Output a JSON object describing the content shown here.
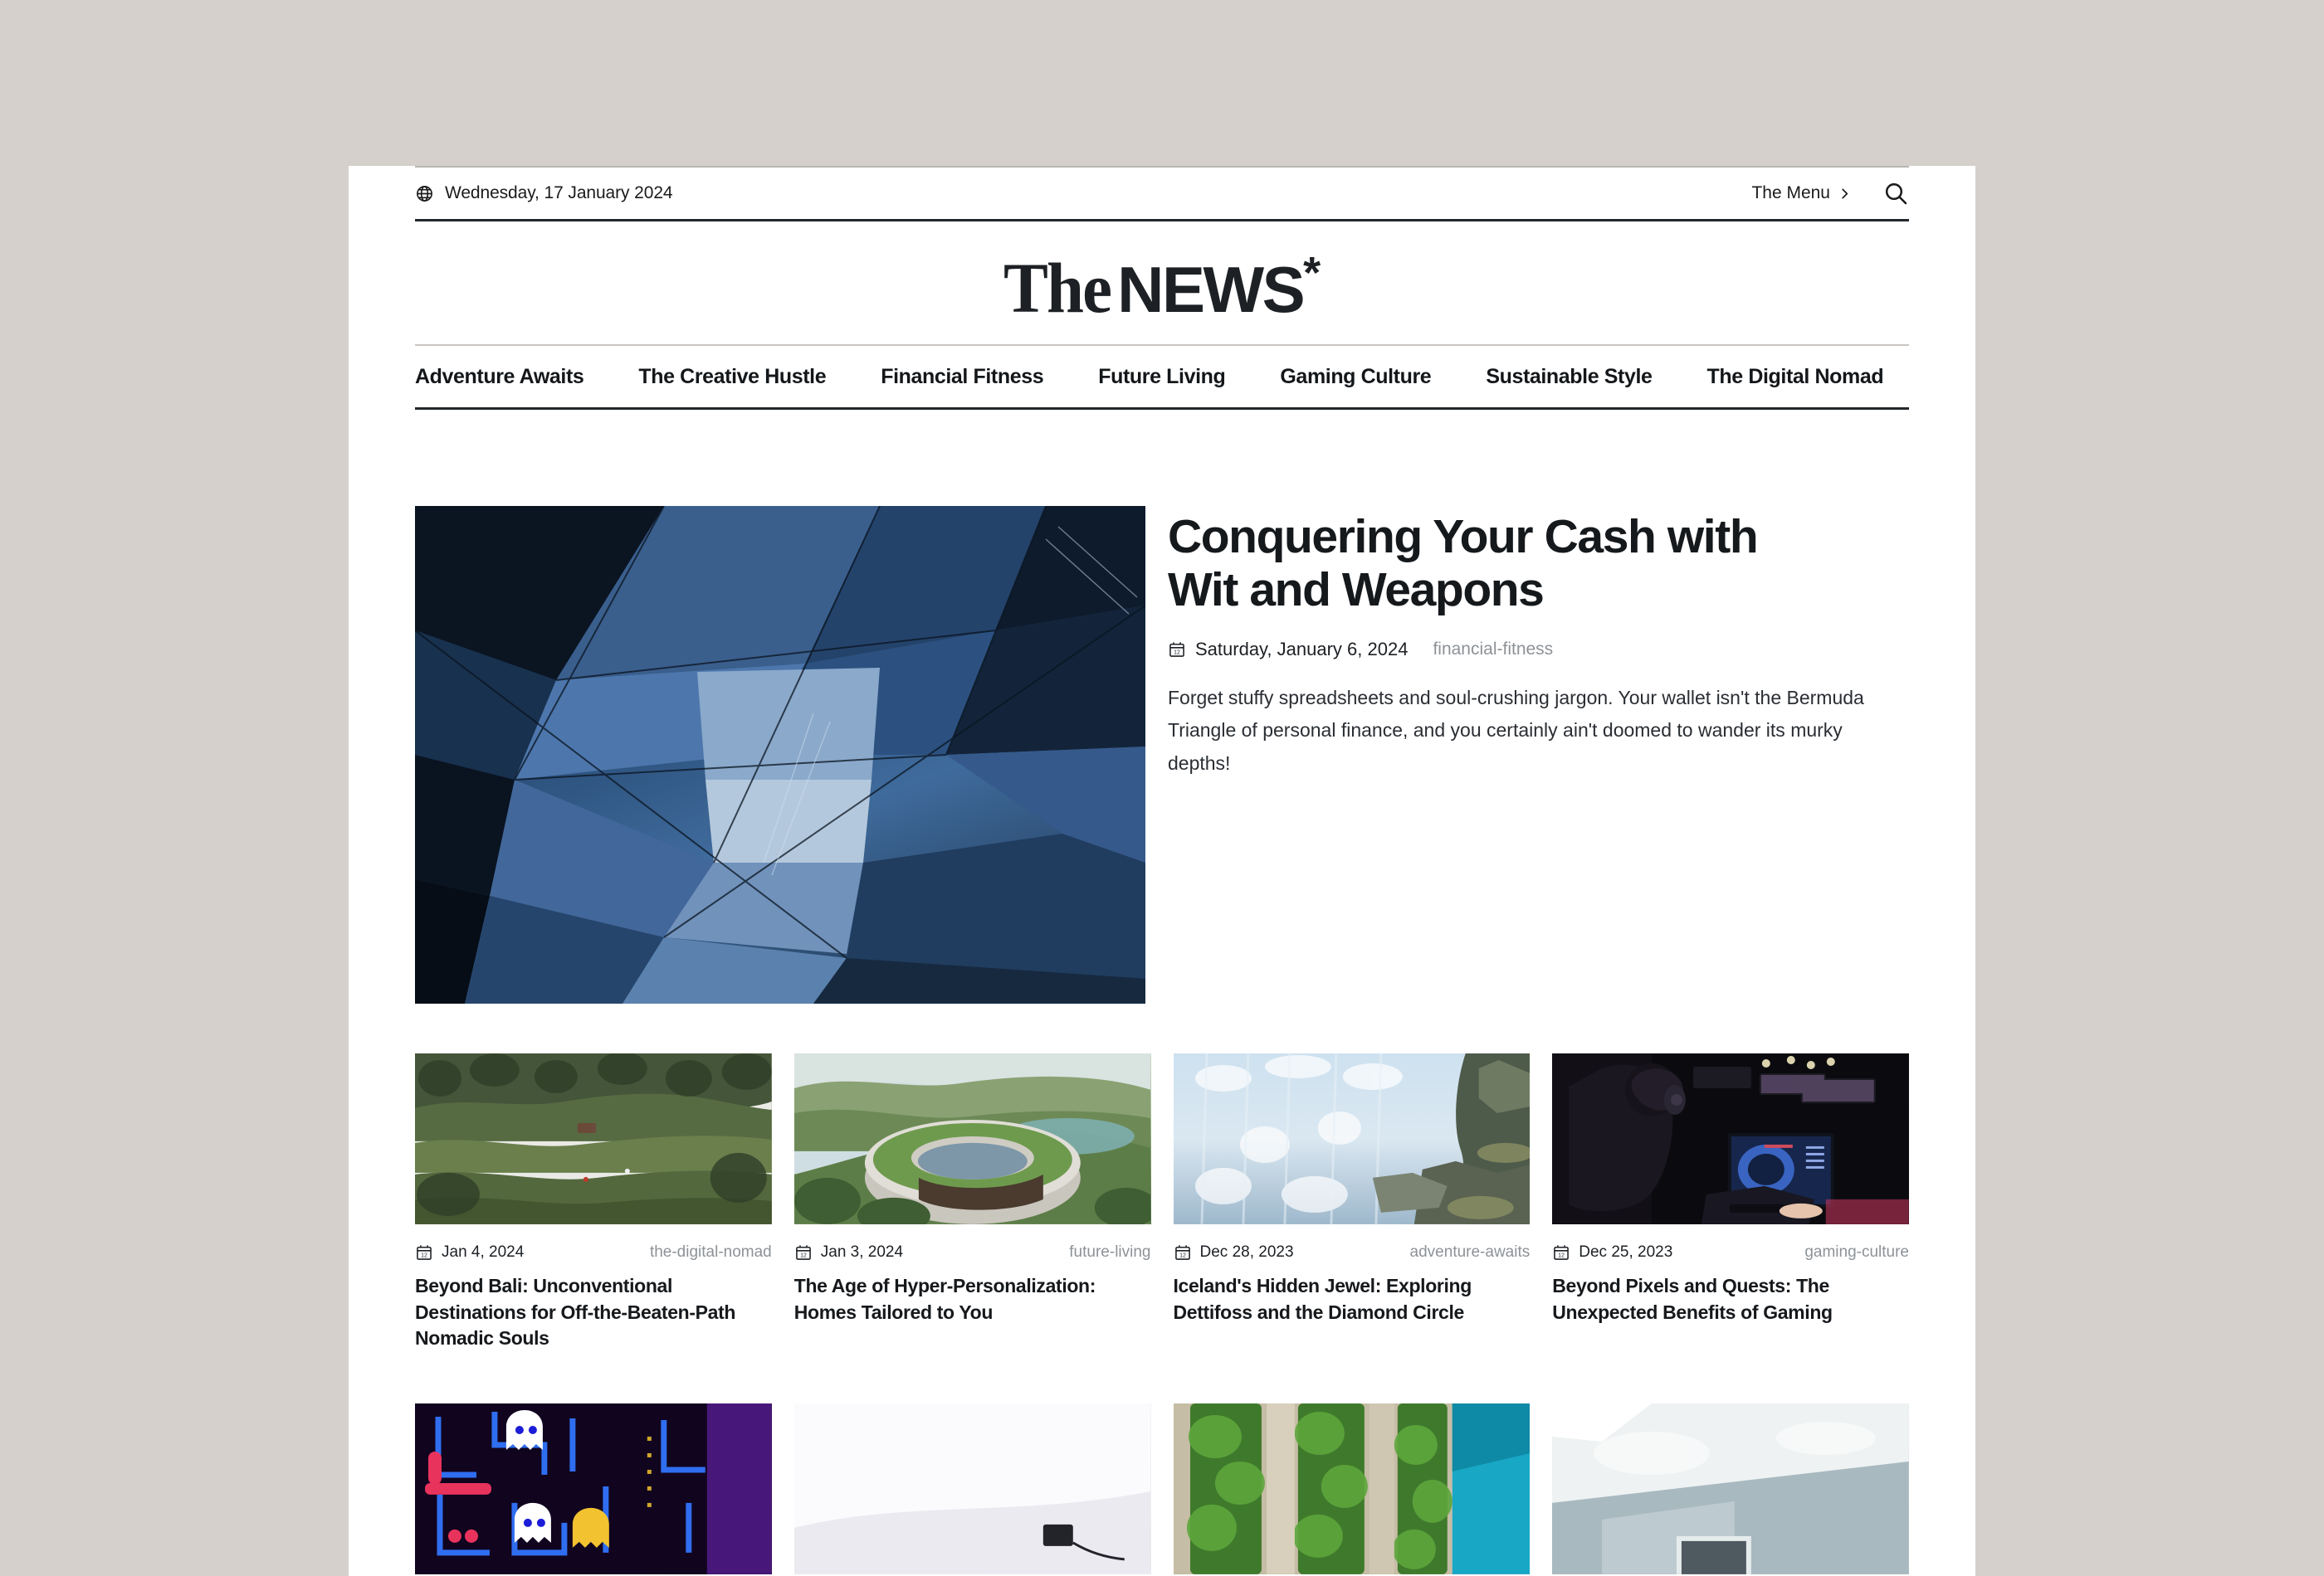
{
  "topbar": {
    "globe_icon": "globe-icon",
    "date": "Wednesday, 17 January 2024",
    "menu_label": "The Menu",
    "chevron_icon": "chevron-right-icon",
    "search_icon": "search-icon"
  },
  "masthead": {
    "logo_the": "The",
    "logo_news": "NEWS",
    "logo_star": "*"
  },
  "nav": {
    "items": [
      {
        "label": "Adventure Awaits"
      },
      {
        "label": "The Creative Hustle"
      },
      {
        "label": "Financial Fitness"
      },
      {
        "label": "Future Living"
      },
      {
        "label": "Gaming Culture"
      },
      {
        "label": "Sustainable Style"
      },
      {
        "label": "The Digital Nomad"
      }
    ]
  },
  "hero": {
    "title": "Conquering Your Cash with Wit and Weapons",
    "calendar_icon": "calendar-icon",
    "date": "Saturday, January 6, 2024",
    "category": "financial-fitness",
    "excerpt": "Forget stuffy spreadsheets and soul-crushing jargon. Your wallet isn't the Bermuda Triangle of personal finance, and you certainly ain't doomed to wander its murky depths!",
    "image_alt": "blue-faceted-glass-architecture"
  },
  "cards_row1": [
    {
      "date": "Jan 4, 2024",
      "category": "the-digital-nomad",
      "title": "Beyond Bali: Unconventional Destinations for Off-the-Beaten-Path Nomadic Souls",
      "image_alt": "bali-rice-terraces"
    },
    {
      "date": "Jan 3, 2024",
      "category": "future-living",
      "title": "The Age of Hyper-Personalization: Homes Tailored to You",
      "image_alt": "circular-green-roof-house"
    },
    {
      "date": "Dec 28, 2023",
      "category": "adventure-awaits",
      "title": "Iceland's Hidden Jewel: Exploring Dettifoss and the Diamond Circle",
      "image_alt": "dettifoss-waterfall"
    },
    {
      "date": "Dec 25, 2023",
      "category": "gaming-culture",
      "title": "Beyond Pixels and Quests: The Unexpected Benefits of Gaming",
      "image_alt": "esports-gamer-at-monitor"
    }
  ],
  "cards_row2": [
    {
      "image_alt": "retro-arcade-neon-game"
    },
    {
      "image_alt": "white-minimal-wall-with-plug"
    },
    {
      "image_alt": "green-vertical-garden-facade"
    },
    {
      "image_alt": "pale-interior-room"
    }
  ],
  "colors": {
    "backdrop": "#d5d0cb",
    "page": "#ffffff",
    "ink": "#16191c",
    "muted": "#8d9297",
    "rule": "#23272b"
  }
}
